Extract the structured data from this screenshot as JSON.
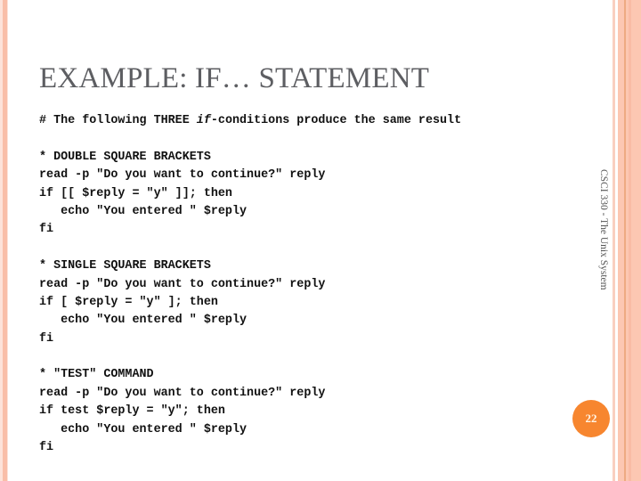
{
  "slide": {
    "title": "EXAMPLE: IF… STATEMENT",
    "footer_vertical": "CSCI 330 - The Unix System",
    "page_number": "22",
    "colors": {
      "accent": "#f7862f",
      "border_peach": "#fcc7b2",
      "title_gray": "#5d5e62"
    }
  },
  "code": {
    "intro": {
      "prefix": "# The following THREE ",
      "italic": "if",
      "suffix": "-conditions produce the same result"
    },
    "lines": [
      "",
      "* DOUBLE SQUARE BRACKETS",
      "read -p \"Do you want to continue?\" reply",
      "if [[ $reply = \"y\" ]]; then",
      "   echo \"You entered \" $reply",
      "fi",
      "",
      "* SINGLE SQUARE BRACKETS",
      "read -p \"Do you want to continue?\" reply",
      "if [ $reply = \"y\" ]; then",
      "   echo \"You entered \" $reply",
      "fi",
      "",
      "* \"TEST\" COMMAND",
      "read -p \"Do you want to continue?\" reply",
      "if test $reply = \"y\"; then",
      "   echo \"You entered \" $reply",
      "fi"
    ]
  }
}
